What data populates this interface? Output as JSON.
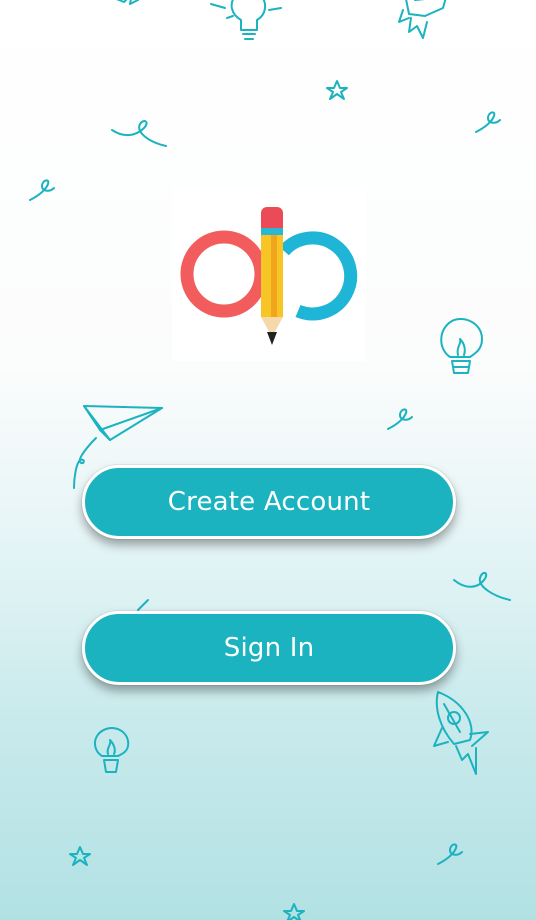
{
  "colors": {
    "accent": "#1ab3bf",
    "button_text": "#ffffff",
    "logo_red": "#f25c5c",
    "logo_blue": "#1eb5d6",
    "pencil_yellow": "#f7c526"
  },
  "logo": {
    "icon": "pencil-infinity-logo"
  },
  "buttons": {
    "create_account": "Create Account",
    "sign_in": "Sign In"
  },
  "background": {
    "doodles": [
      "lightbulb-icon",
      "rocket-icon",
      "star-icon",
      "paper-plane-icon",
      "squiggle-icon"
    ]
  }
}
